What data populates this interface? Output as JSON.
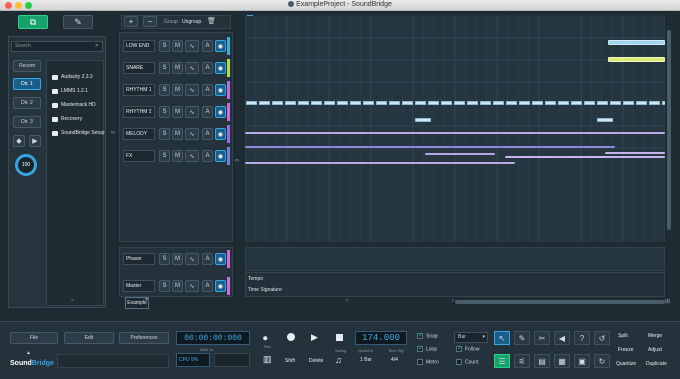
{
  "window": {
    "title": "ExampleProject - SoundBridge"
  },
  "browser": {
    "search_placeholder": "Search",
    "nav": [
      "Recent",
      "Dir. 1",
      "Dir. 2",
      "Dir. 3"
    ],
    "files": [
      "Audacity 2.3.3",
      "LMMS 1.2.1",
      "Mastertrack HD",
      "Recovery",
      "SoundBridge Setup"
    ],
    "volume_knob": "100"
  },
  "track_toolbar": {
    "add": "+",
    "remove": "−",
    "group": "Group",
    "ungroup": "Ungroup",
    "delete": "trash-icon"
  },
  "tracks": [
    {
      "name": "LOW END",
      "color": "#3aaed8"
    },
    {
      "name": "SNARE",
      "color": "#b5d94a"
    },
    {
      "name": "RHYTHM 1",
      "color": "#c16be0"
    },
    {
      "name": "RHYTHM 2",
      "color": "#d06ae3"
    },
    {
      "name": "MELODY",
      "color": "#9e6ae3"
    },
    {
      "name": "FX",
      "color": "#7a7ae0"
    }
  ],
  "buses": [
    {
      "name": "Phaser",
      "color": "#d06ae3"
    },
    {
      "name": "Master",
      "color": "#d06ae3"
    }
  ],
  "track_buttons": {
    "solo": "S",
    "mute": "M",
    "auto": "A"
  },
  "bottom_tab": "Example",
  "automation_lanes": {
    "tempo": "Tempo",
    "time_signature": "Time Signature"
  },
  "bottom": {
    "file": "File",
    "edit": "Edit",
    "preferences": "Preferences",
    "time": "00:00:00:000",
    "cpu_label": "CPU 9%",
    "midi_in": "MIDI In",
    "shift": "Shift",
    "delete": "Delete",
    "swing": "Swing",
    "tempo": "174.000",
    "quant_label": "Quant to",
    "quant_value": "1 Bar",
    "timesig_label": "Time Sig",
    "timesig_value": "4/4",
    "snap": "Snap",
    "loop": "Loop",
    "metro": "Metro",
    "bar": "Bar",
    "follow": "Follow",
    "count": "Count",
    "split": "Split",
    "merge": "Merge",
    "freeze": "Freeze",
    "adjust": "Adjust",
    "quantize": "Quantize",
    "duplicate": "Duplicate",
    "logo_sound": "Sound",
    "logo_bridge": "Bridge",
    "rec": "Rec"
  },
  "colors": {
    "accent": "#16a36b",
    "lcd": "#42a8e8"
  }
}
